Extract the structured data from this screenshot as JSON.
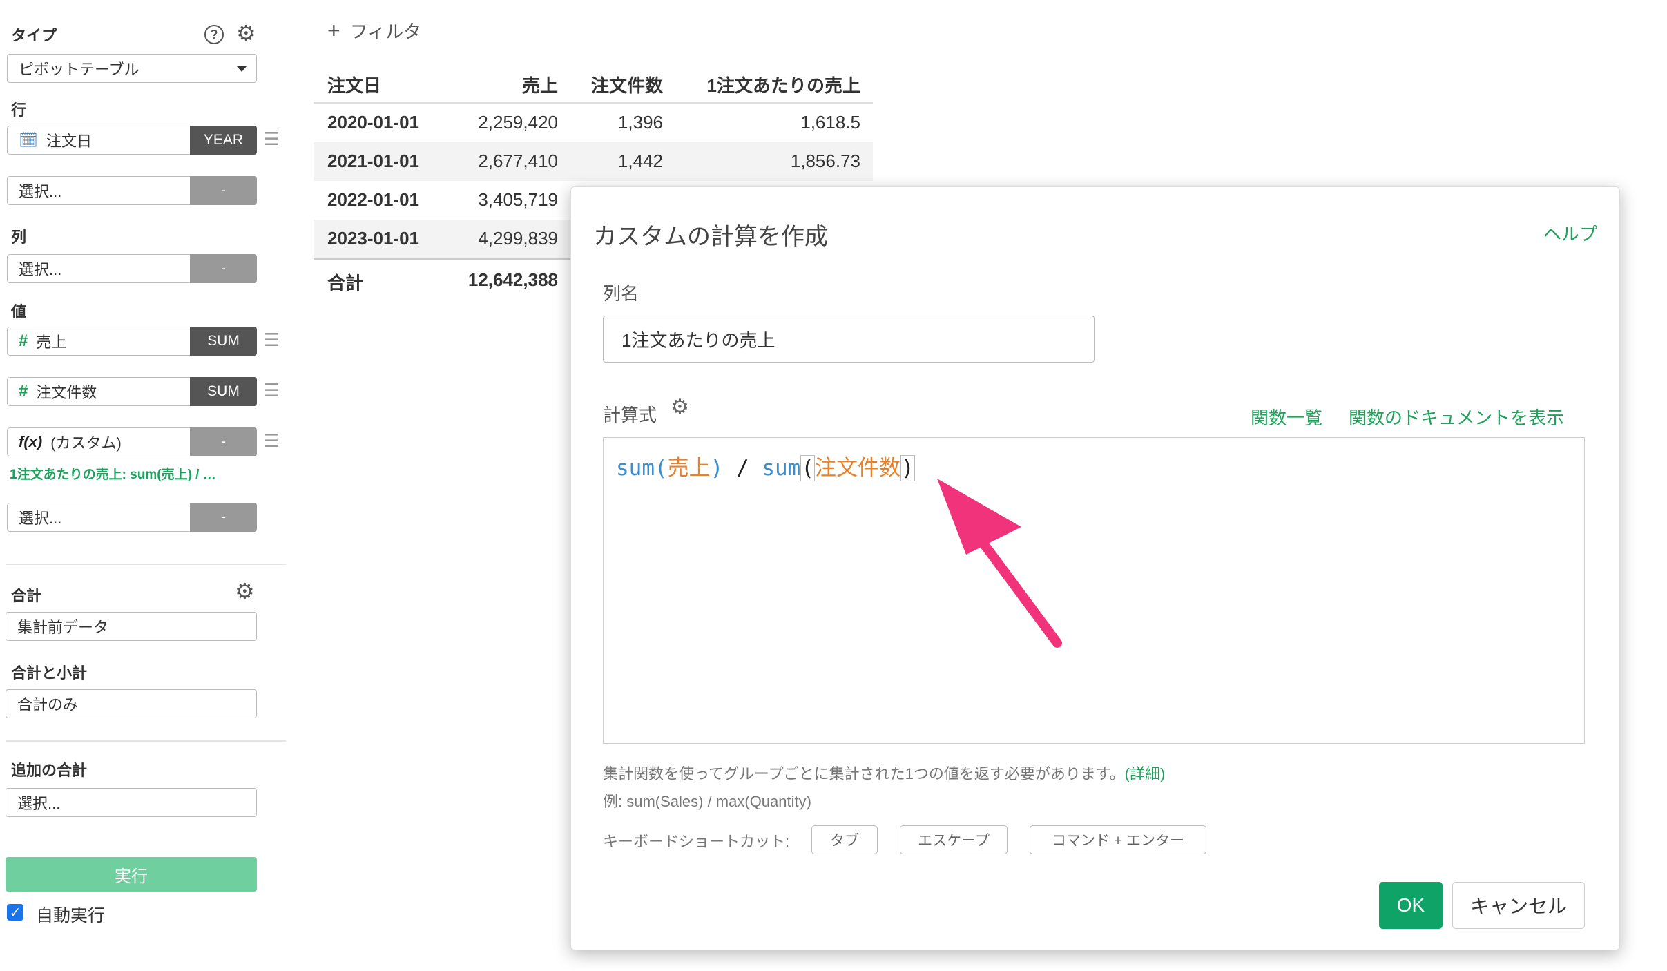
{
  "sidebar": {
    "type_label": "タイプ",
    "type_value": "ピボットテーブル",
    "help_icon_text": "?",
    "row_label": "行",
    "row_field": {
      "name": "注文日",
      "agg": "YEAR"
    },
    "row_select": {
      "placeholder": "選択...",
      "agg": "-"
    },
    "col_label": "列",
    "col_select": {
      "placeholder": "選択...",
      "agg": "-"
    },
    "value_label": "値",
    "value_fields": [
      {
        "icon": "#",
        "name": "売上",
        "agg": "SUM"
      },
      {
        "icon": "#",
        "name": "注文件数",
        "agg": "SUM"
      },
      {
        "icon": "f(x)",
        "name": "(カスタム)",
        "agg": "-"
      }
    ],
    "custom_note": "1注文あたりの売上: sum(売上) / …",
    "value_select": {
      "placeholder": "選択...",
      "agg": "-"
    },
    "total_label": "合計",
    "total_value": "集計前データ",
    "subtotal_label": "合計と小計",
    "subtotal_value": "合計のみ",
    "extra_total_label": "追加の合計",
    "extra_total_value": "選択...",
    "run_button": "実行",
    "auto_run_label": "自動実行",
    "auto_run_checked": "✓"
  },
  "filter": {
    "icon": "+",
    "label": "フィルタ"
  },
  "table": {
    "headers": [
      "注文日",
      "売上",
      "注文件数",
      "1注文あたりの売上"
    ],
    "rows": [
      [
        "2020-01-01",
        "2,259,420",
        "1,396",
        "1,618.5"
      ],
      [
        "2021-01-01",
        "2,677,410",
        "1,442",
        "1,856.73"
      ],
      [
        "2022-01-01",
        "3,405,719",
        "",
        ""
      ],
      [
        "2023-01-01",
        "4,299,839",
        "",
        ""
      ]
    ],
    "total_row": [
      "合計",
      "12,642,388"
    ]
  },
  "dialog": {
    "title": "カスタムの計算を作成",
    "help_link": "ヘルプ",
    "column_name_label": "列名",
    "column_name_value": "1注文あたりの売上",
    "formula_label": "計算式",
    "function_list_link": "関数一覧",
    "function_doc_link": "関数のドキュメントを表示",
    "formula": {
      "fn1": "sum(",
      "col1": "売上",
      "close1": ")",
      "op": " / ",
      "fn2": "sum",
      "open2": "(",
      "col2": "注文件数",
      "close2": ")"
    },
    "hint_text": "集計関数を使ってグループごとに集計された1つの値を返す必要があります。",
    "hint_link": "(詳細)",
    "example_text": "例: sum(Sales) / max(Quantity)",
    "shortcut_label": "キーボードショートカット:",
    "shortcuts": [
      "タブ",
      "エスケープ",
      "コマンド + エンター"
    ],
    "ok_button": "OK",
    "cancel_button": "キャンセル"
  },
  "colors": {
    "accent_green": "#1fa35a",
    "arrow_pink": "#f0337a",
    "fn_blue": "#3a8ecf",
    "col_orange": "#e8822a"
  }
}
